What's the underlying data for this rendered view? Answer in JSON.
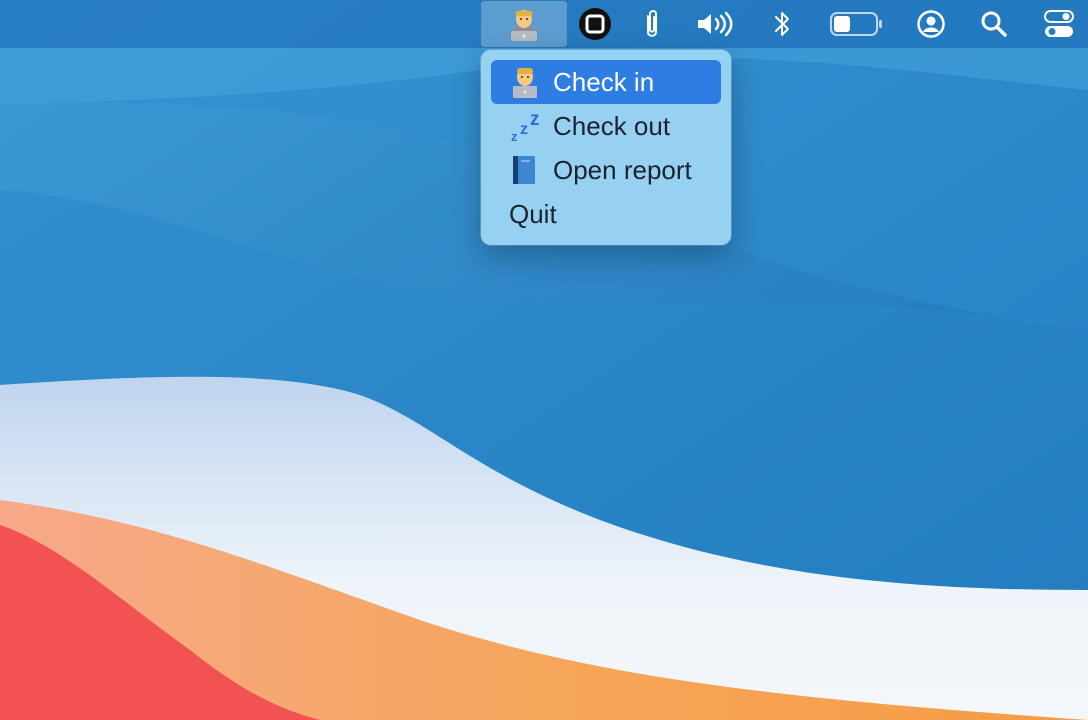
{
  "menubar": {
    "items": [
      {
        "icon": "person-with-laptop-icon",
        "active": true
      },
      {
        "icon": "stop-square-icon"
      },
      {
        "icon": "paperclip-icon"
      },
      {
        "icon": "speaker-volume-icon"
      },
      {
        "icon": "bluetooth-icon"
      },
      {
        "icon": "battery-icon"
      },
      {
        "icon": "user-account-icon"
      },
      {
        "icon": "search-icon"
      },
      {
        "icon": "control-center-icon"
      }
    ]
  },
  "menu": {
    "items": [
      {
        "label": "Check in",
        "icon": "person-with-laptop-icon",
        "highlighted": true
      },
      {
        "label": "Check out",
        "icon": "zzz-sleep-icon"
      },
      {
        "label": "Open report",
        "icon": "blue-book-icon"
      },
      {
        "label": "Quit"
      }
    ]
  },
  "colors": {
    "menu_highlight": "#2e7de3",
    "menu_background": "#a0d7f5",
    "wallpaper_blue": "#1f7dc0",
    "wallpaper_orange": "#f5a04b",
    "wallpaper_red": "#f25252"
  }
}
